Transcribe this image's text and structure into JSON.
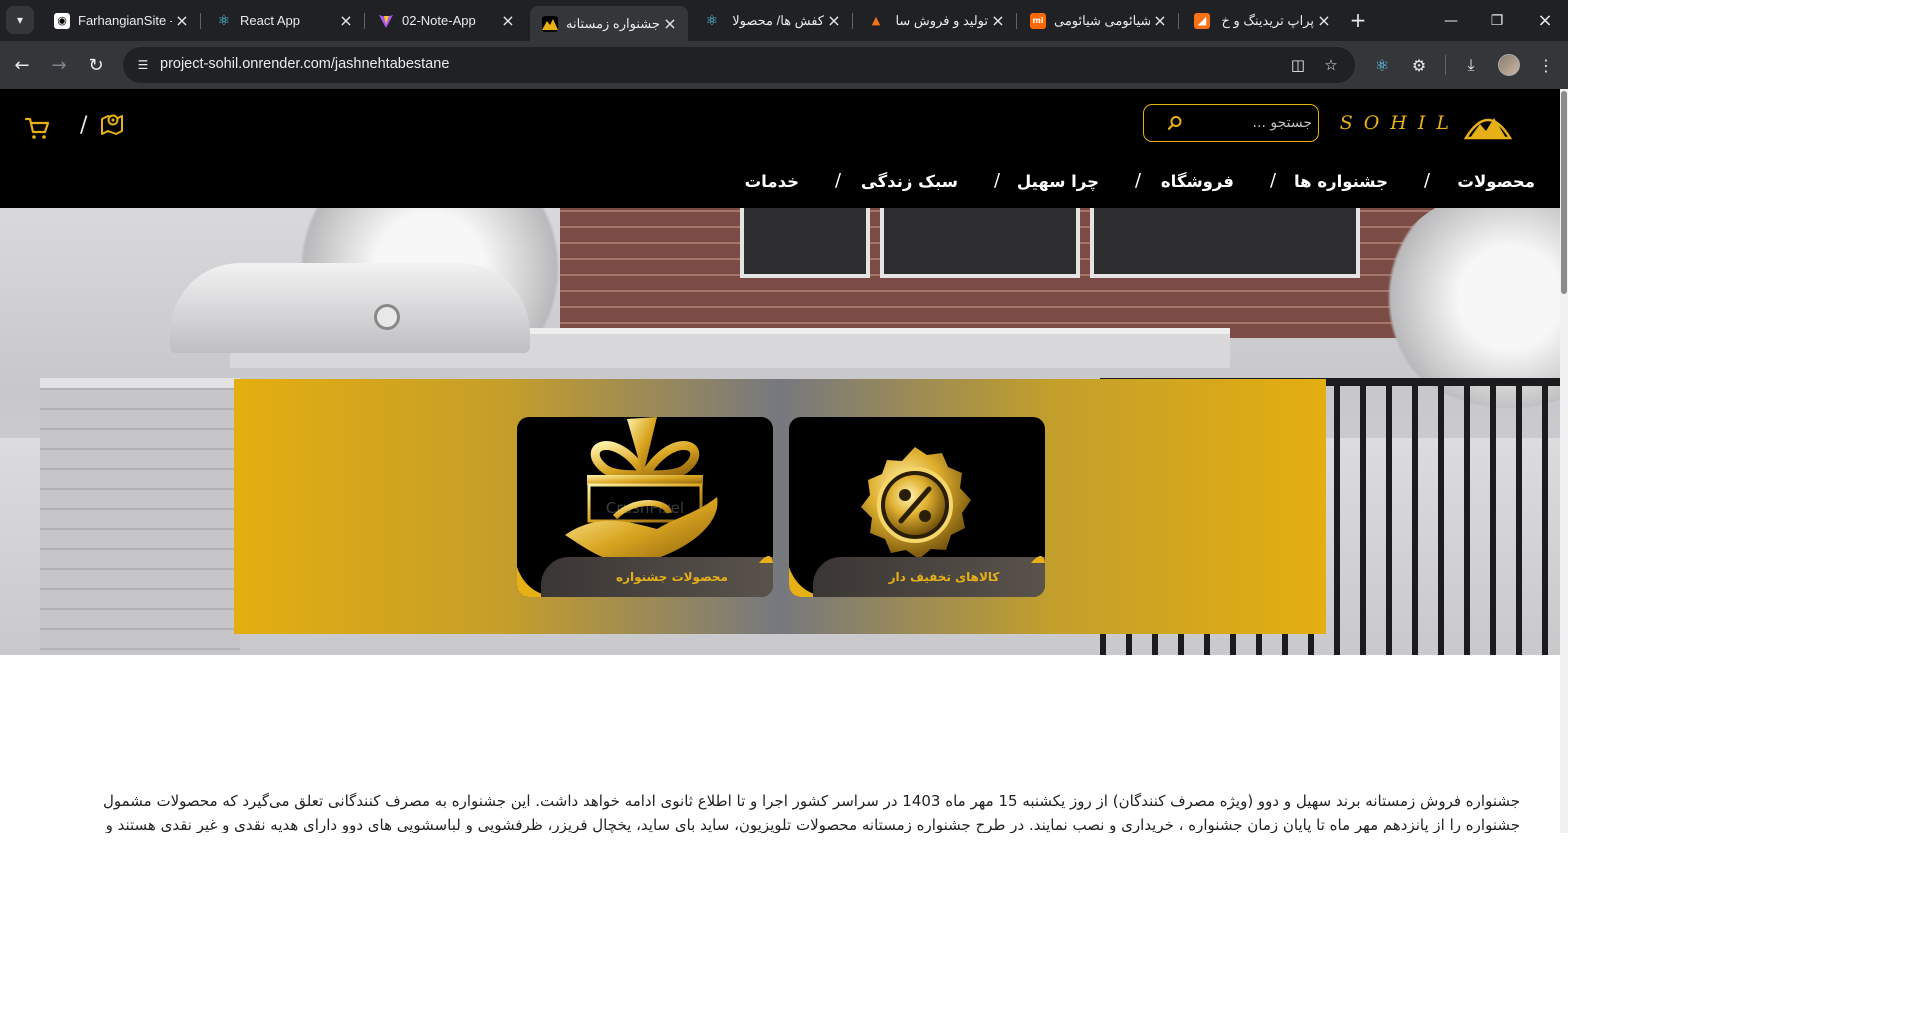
{
  "browser": {
    "tabs": [
      {
        "title": "FarhangianSite -",
        "favicon": "figma-icon",
        "active": false
      },
      {
        "title": "React App",
        "favicon": "react-icon",
        "active": false
      },
      {
        "title": "02-Note-App",
        "favicon": "vite-icon",
        "active": false
      },
      {
        "title": "جشنواره زمستانه",
        "favicon": "sohil-icon",
        "active": true
      },
      {
        "title": "کفش ها/ محصولا",
        "favicon": "react-icon",
        "active": false
      },
      {
        "title": "تولید و فروش سا",
        "favicon": "flame-icon",
        "active": false
      },
      {
        "title": "شیائومی شیائومی",
        "favicon": "mi-icon",
        "active": false
      },
      {
        "title": "پراپ تریدینگ و خ",
        "favicon": "prop-icon",
        "active": false
      }
    ],
    "url": "project-sohil.onrender.com/jashnehtabestane"
  },
  "header": {
    "logo_text": "SOHIL",
    "search_placeholder": "جستجو ...",
    "slash": "/"
  },
  "nav": {
    "items": [
      "محصولات",
      "جشنواره ها",
      "فروشگاه",
      "چرا سهیل",
      "سبک زندگی",
      "خدمات"
    ],
    "separator": "/"
  },
  "colors": {
    "accent": "#e6b016",
    "header_bg": "#000000"
  },
  "promo": {
    "cards": [
      {
        "label": "کالاهای تخفیف دار",
        "icon": "discount-badge-icon"
      },
      {
        "label": "محصولات جشنواره",
        "icon": "gift-icon",
        "watermark": "CrushPixel"
      }
    ]
  },
  "article": {
    "line1": "جشنواره فروش زمستانه برند سهیل و دوو (ویژه مصرف کنندگان) از روز یکشنبه 15 مهر ماه 1403 در سراسر کشور اجرا و تا اطلاع ثانوی ادامه خواهد داشت. این جشنواره به مصرف کنندگانی تعلق می‌گیرد که محصولات مشمول",
    "line2": "جشنواره را از پانزدهم مهر ماه تا پایان زمان جشنواره ، خریداری و نصب نمایند. در طرح جشنواره زمستانه محصولات تلویزیون، ساید بای ساید، یخچال فریزر، ظرفشویی و لباسشویی های دوو دارای هدیه نقدی و غیر نقدی هستند و"
  }
}
